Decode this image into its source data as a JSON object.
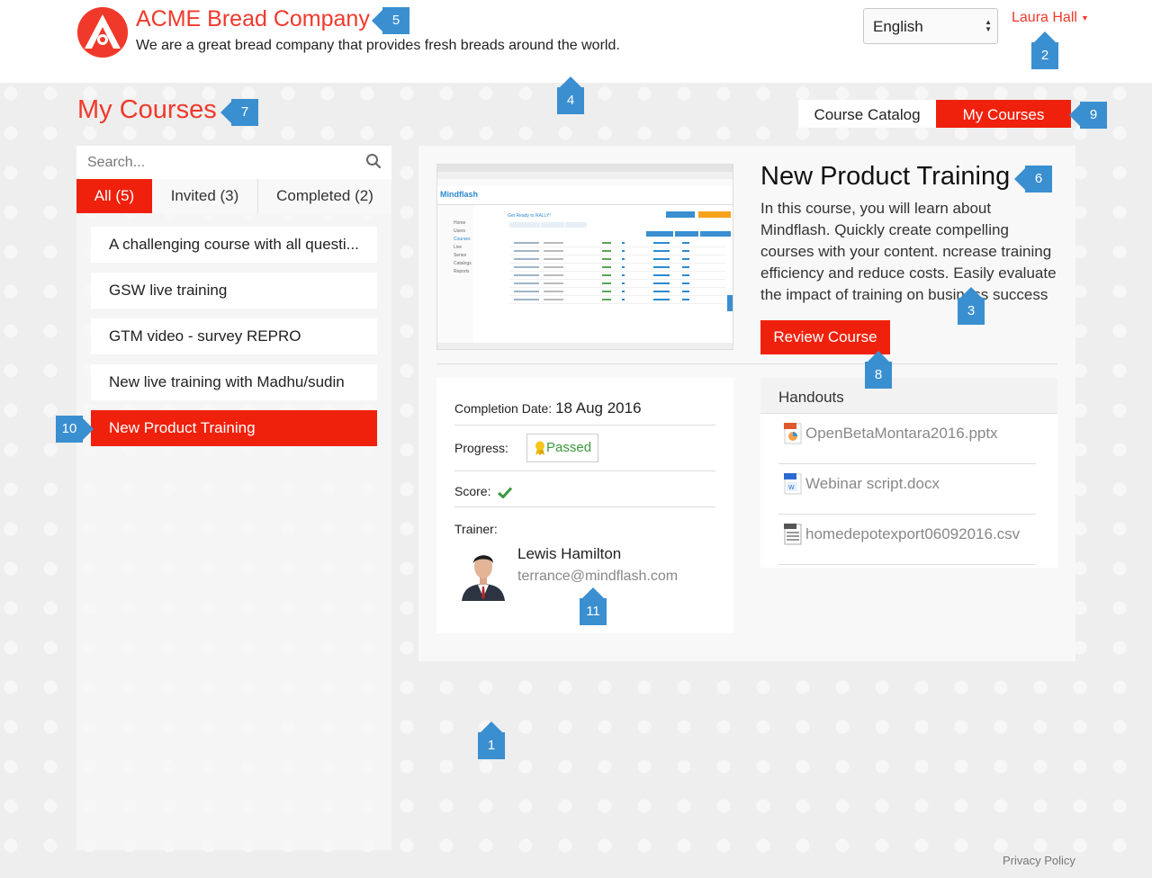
{
  "header": {
    "company_name": "ACME Bread Company",
    "tagline": "We are a great bread company that provides fresh breads around the world.",
    "language": "English",
    "user_name": "Laura Hall",
    "logo_icon": "acme-a-logo"
  },
  "page": {
    "title": "My Courses",
    "nav_tabs": [
      {
        "label": "Course Catalog",
        "active": false
      },
      {
        "label": "My Courses",
        "active": true
      }
    ]
  },
  "sidebar": {
    "search_placeholder": "Search...",
    "filter_tabs": [
      {
        "label": "All (5)",
        "active": true
      },
      {
        "label": "Invited (3)",
        "active": false
      },
      {
        "label": "Completed (2)",
        "active": false
      }
    ],
    "courses": [
      {
        "label": "A challenging course with all questi...",
        "active": false
      },
      {
        "label": "GSW live training",
        "active": false
      },
      {
        "label": "GTM video - survey REPRO",
        "active": false
      },
      {
        "label": "New live training with Madhu/sudin",
        "active": false
      },
      {
        "label": "New Product Training",
        "active": true
      }
    ]
  },
  "course": {
    "title": "New Product Training",
    "description": "In this course, you will learn about Mindflash. Quickly create compelling courses with your content. ncrease training efficiency and reduce costs. Easily evaluate the impact of training on business success",
    "review_button": "Review Course",
    "completion_label": "Completion Date:",
    "completion_date": "18 Aug 2016",
    "progress_label": "Progress:",
    "progress_value": "Passed",
    "score_label": "Score:",
    "trainer_label": "Trainer:",
    "trainer_name": "Lewis Hamilton",
    "trainer_email": "terrance@mindflash.com"
  },
  "handouts": {
    "title": "Handouts",
    "files": [
      {
        "name": "OpenBetaMontara2016.pptx",
        "icon": "pptx-file-icon"
      },
      {
        "name": "Webinar script.docx",
        "icon": "docx-file-icon"
      },
      {
        "name": "homedepotexport06092016.csv",
        "icon": "csv-file-icon"
      }
    ]
  },
  "thumbnail": {
    "brand": "Mindflash",
    "heading": "Get Ready to RALLY!",
    "nav_items": [
      "Home",
      "Users",
      "Courses",
      "Live",
      "Series",
      "Catalogs",
      "Reports"
    ]
  },
  "markers": [
    "1",
    "2",
    "3",
    "4",
    "5",
    "6",
    "7",
    "8",
    "9",
    "10",
    "11"
  ],
  "footer": {
    "privacy": "Privacy Policy"
  },
  "colors": {
    "accent": "#f0210c",
    "brand": "#f0392b",
    "marker": "#3a8fd0"
  }
}
